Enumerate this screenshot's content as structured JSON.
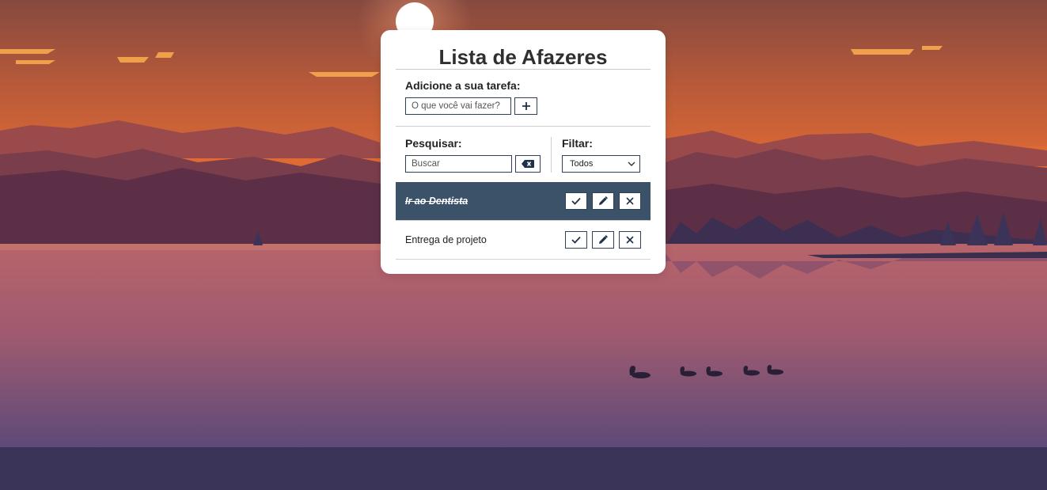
{
  "app": {
    "title": "Lista de Afazeres"
  },
  "add_section": {
    "label": "Adicione a sua tarefa:",
    "input_placeholder": "O que você vai fazer?",
    "input_value": "",
    "add_button_icon": "plus-icon"
  },
  "search_section": {
    "label": "Pesquisar:",
    "input_placeholder": "Buscar",
    "input_value": "",
    "clear_button_icon": "backspace-icon"
  },
  "filter_section": {
    "label": "Filtar:",
    "selected": "Todos"
  },
  "todos": [
    {
      "text": "Ir ao Dentista",
      "done": true
    },
    {
      "text": "Entrega de projeto",
      "done": false
    }
  ],
  "todo_action_icons": [
    "check-icon",
    "pencil-icon",
    "close-icon"
  ],
  "colors": {
    "accent": "#2d4057",
    "done_row": "#3c5269",
    "sky_top": "#8a4b3f",
    "sky_bottom": "#d76a3a",
    "sun": "#ffffff",
    "water_bottom": "#3a3459"
  }
}
